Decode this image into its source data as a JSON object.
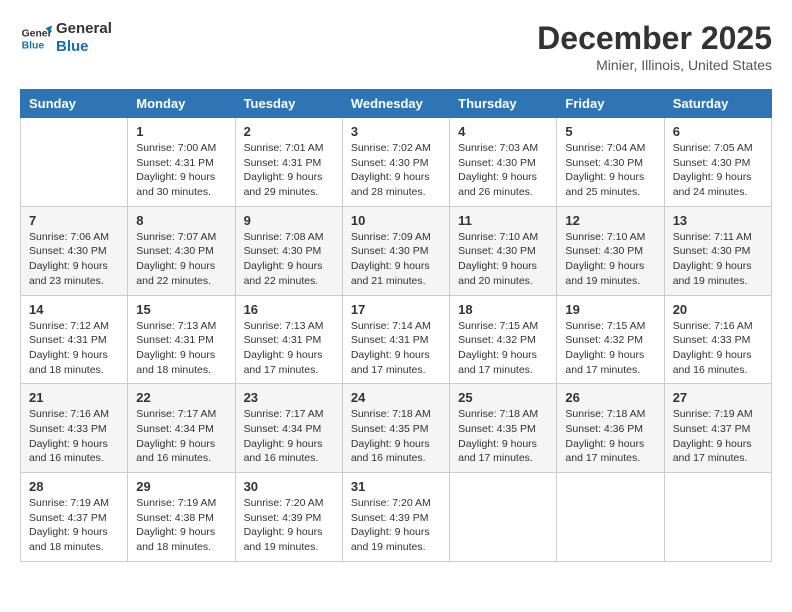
{
  "header": {
    "logo_line1": "General",
    "logo_line2": "Blue",
    "month": "December 2025",
    "location": "Minier, Illinois, United States"
  },
  "weekdays": [
    "Sunday",
    "Monday",
    "Tuesday",
    "Wednesday",
    "Thursday",
    "Friday",
    "Saturday"
  ],
  "weeks": [
    [
      {
        "num": "",
        "content": ""
      },
      {
        "num": "1",
        "content": "Sunrise: 7:00 AM\nSunset: 4:31 PM\nDaylight: 9 hours\nand 30 minutes."
      },
      {
        "num": "2",
        "content": "Sunrise: 7:01 AM\nSunset: 4:31 PM\nDaylight: 9 hours\nand 29 minutes."
      },
      {
        "num": "3",
        "content": "Sunrise: 7:02 AM\nSunset: 4:30 PM\nDaylight: 9 hours\nand 28 minutes."
      },
      {
        "num": "4",
        "content": "Sunrise: 7:03 AM\nSunset: 4:30 PM\nDaylight: 9 hours\nand 26 minutes."
      },
      {
        "num": "5",
        "content": "Sunrise: 7:04 AM\nSunset: 4:30 PM\nDaylight: 9 hours\nand 25 minutes."
      },
      {
        "num": "6",
        "content": "Sunrise: 7:05 AM\nSunset: 4:30 PM\nDaylight: 9 hours\nand 24 minutes."
      }
    ],
    [
      {
        "num": "7",
        "content": "Sunrise: 7:06 AM\nSunset: 4:30 PM\nDaylight: 9 hours\nand 23 minutes."
      },
      {
        "num": "8",
        "content": "Sunrise: 7:07 AM\nSunset: 4:30 PM\nDaylight: 9 hours\nand 22 minutes."
      },
      {
        "num": "9",
        "content": "Sunrise: 7:08 AM\nSunset: 4:30 PM\nDaylight: 9 hours\nand 22 minutes."
      },
      {
        "num": "10",
        "content": "Sunrise: 7:09 AM\nSunset: 4:30 PM\nDaylight: 9 hours\nand 21 minutes."
      },
      {
        "num": "11",
        "content": "Sunrise: 7:10 AM\nSunset: 4:30 PM\nDaylight: 9 hours\nand 20 minutes."
      },
      {
        "num": "12",
        "content": "Sunrise: 7:10 AM\nSunset: 4:30 PM\nDaylight: 9 hours\nand 19 minutes."
      },
      {
        "num": "13",
        "content": "Sunrise: 7:11 AM\nSunset: 4:30 PM\nDaylight: 9 hours\nand 19 minutes."
      }
    ],
    [
      {
        "num": "14",
        "content": "Sunrise: 7:12 AM\nSunset: 4:31 PM\nDaylight: 9 hours\nand 18 minutes."
      },
      {
        "num": "15",
        "content": "Sunrise: 7:13 AM\nSunset: 4:31 PM\nDaylight: 9 hours\nand 18 minutes."
      },
      {
        "num": "16",
        "content": "Sunrise: 7:13 AM\nSunset: 4:31 PM\nDaylight: 9 hours\nand 17 minutes."
      },
      {
        "num": "17",
        "content": "Sunrise: 7:14 AM\nSunset: 4:31 PM\nDaylight: 9 hours\nand 17 minutes."
      },
      {
        "num": "18",
        "content": "Sunrise: 7:15 AM\nSunset: 4:32 PM\nDaylight: 9 hours\nand 17 minutes."
      },
      {
        "num": "19",
        "content": "Sunrise: 7:15 AM\nSunset: 4:32 PM\nDaylight: 9 hours\nand 17 minutes."
      },
      {
        "num": "20",
        "content": "Sunrise: 7:16 AM\nSunset: 4:33 PM\nDaylight: 9 hours\nand 16 minutes."
      }
    ],
    [
      {
        "num": "21",
        "content": "Sunrise: 7:16 AM\nSunset: 4:33 PM\nDaylight: 9 hours\nand 16 minutes."
      },
      {
        "num": "22",
        "content": "Sunrise: 7:17 AM\nSunset: 4:34 PM\nDaylight: 9 hours\nand 16 minutes."
      },
      {
        "num": "23",
        "content": "Sunrise: 7:17 AM\nSunset: 4:34 PM\nDaylight: 9 hours\nand 16 minutes."
      },
      {
        "num": "24",
        "content": "Sunrise: 7:18 AM\nSunset: 4:35 PM\nDaylight: 9 hours\nand 16 minutes."
      },
      {
        "num": "25",
        "content": "Sunrise: 7:18 AM\nSunset: 4:35 PM\nDaylight: 9 hours\nand 17 minutes."
      },
      {
        "num": "26",
        "content": "Sunrise: 7:18 AM\nSunset: 4:36 PM\nDaylight: 9 hours\nand 17 minutes."
      },
      {
        "num": "27",
        "content": "Sunrise: 7:19 AM\nSunset: 4:37 PM\nDaylight: 9 hours\nand 17 minutes."
      }
    ],
    [
      {
        "num": "28",
        "content": "Sunrise: 7:19 AM\nSunset: 4:37 PM\nDaylight: 9 hours\nand 18 minutes."
      },
      {
        "num": "29",
        "content": "Sunrise: 7:19 AM\nSunset: 4:38 PM\nDaylight: 9 hours\nand 18 minutes."
      },
      {
        "num": "30",
        "content": "Sunrise: 7:20 AM\nSunset: 4:39 PM\nDaylight: 9 hours\nand 19 minutes."
      },
      {
        "num": "31",
        "content": "Sunrise: 7:20 AM\nSunset: 4:39 PM\nDaylight: 9 hours\nand 19 minutes."
      },
      {
        "num": "",
        "content": ""
      },
      {
        "num": "",
        "content": ""
      },
      {
        "num": "",
        "content": ""
      }
    ]
  ]
}
